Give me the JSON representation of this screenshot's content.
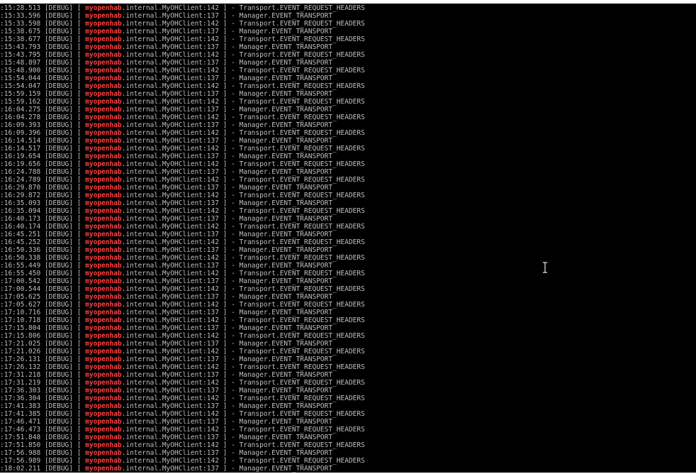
{
  "terminal": {
    "log_lines": [
      {
        "t": ":15:28.513",
        "level": "[DEBUG]",
        "pkg": "myopenhab",
        "cls": ".internal.MyOHClient:142",
        "msg": " ] - Transport.EVENT_REQUEST_HEADERS"
      },
      {
        "t": ":15:33.596",
        "level": "[DEBUG]",
        "pkg": "myopenhab",
        "cls": ".internal.MyOHClient:137",
        "msg": " ] - Manager.EVENT_TRANSPORT"
      },
      {
        "t": ":15:33.598",
        "level": "[DEBUG]",
        "pkg": "myopenhab",
        "cls": ".internal.MyOHClient:142",
        "msg": " ] - Transport.EVENT_REQUEST_HEADERS"
      },
      {
        "t": ":15:38.675",
        "level": "[DEBUG]",
        "pkg": "myopenhab",
        "cls": ".internal.MyOHClient:137",
        "msg": " ] - Manager.EVENT_TRANSPORT"
      },
      {
        "t": ":15:38.677",
        "level": "[DEBUG]",
        "pkg": "myopenhab",
        "cls": ".internal.MyOHClient:142",
        "msg": " ] - Transport.EVENT_REQUEST_HEADERS"
      },
      {
        "t": ":15:43.793",
        "level": "[DEBUG]",
        "pkg": "myopenhab",
        "cls": ".internal.MyOHClient:137",
        "msg": " ] - Manager.EVENT_TRANSPORT"
      },
      {
        "t": ":15:43.795",
        "level": "[DEBUG]",
        "pkg": "myopenhab",
        "cls": ".internal.MyOHClient:142",
        "msg": " ] - Transport.EVENT_REQUEST_HEADERS"
      },
      {
        "t": ":15:48.897",
        "level": "[DEBUG]",
        "pkg": "myopenhab",
        "cls": ".internal.MyOHClient:137",
        "msg": " ] - Manager.EVENT_TRANSPORT"
      },
      {
        "t": ":15:48.900",
        "level": "[DEBUG]",
        "pkg": "myopenhab",
        "cls": ".internal.MyOHClient:142",
        "msg": " ] - Transport.EVENT_REQUEST_HEADERS"
      },
      {
        "t": ":15:54.044",
        "level": "[DEBUG]",
        "pkg": "myopenhab",
        "cls": ".internal.MyOHClient:137",
        "msg": " ] - Manager.EVENT_TRANSPORT"
      },
      {
        "t": ":15:54.047",
        "level": "[DEBUG]",
        "pkg": "myopenhab",
        "cls": ".internal.MyOHClient:142",
        "msg": " ] - Transport.EVENT_REQUEST_HEADERS"
      },
      {
        "t": ":15:59.159",
        "level": "[DEBUG]",
        "pkg": "myopenhab",
        "cls": ".internal.MyOHClient:137",
        "msg": " ] - Manager.EVENT_TRANSPORT"
      },
      {
        "t": ":15:59.162",
        "level": "[DEBUG]",
        "pkg": "myopenhab",
        "cls": ".internal.MyOHClient:142",
        "msg": " ] - Transport.EVENT_REQUEST_HEADERS"
      },
      {
        "t": ":16:04.275",
        "level": "[DEBUG]",
        "pkg": "myopenhab",
        "cls": ".internal.MyOHClient:137",
        "msg": " ] - Manager.EVENT_TRANSPORT"
      },
      {
        "t": ":16:04.278",
        "level": "[DEBUG]",
        "pkg": "myopenhab",
        "cls": ".internal.MyOHClient:142",
        "msg": " ] - Transport.EVENT_REQUEST_HEADERS"
      },
      {
        "t": ":16:09.393",
        "level": "[DEBUG]",
        "pkg": "myopenhab",
        "cls": ".internal.MyOHClient:137",
        "msg": " ] - Manager.EVENT_TRANSPORT"
      },
      {
        "t": ":16:09.396",
        "level": "[DEBUG]",
        "pkg": "myopenhab",
        "cls": ".internal.MyOHClient:142",
        "msg": " ] - Transport.EVENT_REQUEST_HEADERS"
      },
      {
        "t": ":16:14.514",
        "level": "[DEBUG]",
        "pkg": "myopenhab",
        "cls": ".internal.MyOHClient:137",
        "msg": " ] - Manager.EVENT_TRANSPORT"
      },
      {
        "t": ":16:14.517",
        "level": "[DEBUG]",
        "pkg": "myopenhab",
        "cls": ".internal.MyOHClient:142",
        "msg": " ] - Transport.EVENT_REQUEST_HEADERS"
      },
      {
        "t": ":16:19.654",
        "level": "[DEBUG]",
        "pkg": "myopenhab",
        "cls": ".internal.MyOHClient:137",
        "msg": " ] - Manager.EVENT_TRANSPORT"
      },
      {
        "t": ":16:19.656",
        "level": "[DEBUG]",
        "pkg": "myopenhab",
        "cls": ".internal.MyOHClient:142",
        "msg": " ] - Transport.EVENT_REQUEST_HEADERS"
      },
      {
        "t": ":16:24.788",
        "level": "[DEBUG]",
        "pkg": "myopenhab",
        "cls": ".internal.MyOHClient:137",
        "msg": " ] - Manager.EVENT_TRANSPORT"
      },
      {
        "t": ":16:24.789",
        "level": "[DEBUG]",
        "pkg": "myopenhab",
        "cls": ".internal.MyOHClient:142",
        "msg": " ] - Transport.EVENT_REQUEST_HEADERS"
      },
      {
        "t": ":16:29.870",
        "level": "[DEBUG]",
        "pkg": "myopenhab",
        "cls": ".internal.MyOHClient:137",
        "msg": " ] - Manager.EVENT_TRANSPORT"
      },
      {
        "t": ":16:29.872",
        "level": "[DEBUG]",
        "pkg": "myopenhab",
        "cls": ".internal.MyOHClient:142",
        "msg": " ] - Transport.EVENT_REQUEST_HEADERS"
      },
      {
        "t": ":16:35.093",
        "level": "[DEBUG]",
        "pkg": "myopenhab",
        "cls": ".internal.MyOHClient:137",
        "msg": " ] - Manager.EVENT_TRANSPORT"
      },
      {
        "t": ":16:35.094",
        "level": "[DEBUG]",
        "pkg": "myopenhab",
        "cls": ".internal.MyOHClient:142",
        "msg": " ] - Transport.EVENT_REQUEST_HEADERS"
      },
      {
        "t": ":16:40.173",
        "level": "[DEBUG]",
        "pkg": "myopenhab",
        "cls": ".internal.MyOHClient:137",
        "msg": " ] - Manager.EVENT_TRANSPORT"
      },
      {
        "t": ":16:40.174",
        "level": "[DEBUG]",
        "pkg": "myopenhab",
        "cls": ".internal.MyOHClient:142",
        "msg": " ] - Transport.EVENT_REQUEST_HEADERS"
      },
      {
        "t": ":16:45.251",
        "level": "[DEBUG]",
        "pkg": "myopenhab",
        "cls": ".internal.MyOHClient:137",
        "msg": " ] - Manager.EVENT_TRANSPORT"
      },
      {
        "t": ":16:45.252",
        "level": "[DEBUG]",
        "pkg": "myopenhab",
        "cls": ".internal.MyOHClient:142",
        "msg": " ] - Transport.EVENT_REQUEST_HEADERS"
      },
      {
        "t": ":16:50.336",
        "level": "[DEBUG]",
        "pkg": "myopenhab",
        "cls": ".internal.MyOHClient:137",
        "msg": " ] - Manager.EVENT_TRANSPORT"
      },
      {
        "t": ":16:50.338",
        "level": "[DEBUG]",
        "pkg": "myopenhab",
        "cls": ".internal.MyOHClient:142",
        "msg": " ] - Transport.EVENT_REQUEST_HEADERS"
      },
      {
        "t": ":16:55.449",
        "level": "[DEBUG]",
        "pkg": "myopenhab",
        "cls": ".internal.MyOHClient:137",
        "msg": " ] - Manager.EVENT_TRANSPORT"
      },
      {
        "t": ":16:55.450",
        "level": "[DEBUG]",
        "pkg": "myopenhab",
        "cls": ".internal.MyOHClient:142",
        "msg": " ] - Transport.EVENT_REQUEST_HEADERS"
      },
      {
        "t": ":17:00.542",
        "level": "[DEBUG]",
        "pkg": "myopenhab",
        "cls": ".internal.MyOHClient:137",
        "msg": " ] - Manager.EVENT_TRANSPORT"
      },
      {
        "t": ":17:00.544",
        "level": "[DEBUG]",
        "pkg": "myopenhab",
        "cls": ".internal.MyOHClient:142",
        "msg": " ] - Transport.EVENT_REQUEST_HEADERS"
      },
      {
        "t": ":17:05.625",
        "level": "[DEBUG]",
        "pkg": "myopenhab",
        "cls": ".internal.MyOHClient:137",
        "msg": " ] - Manager.EVENT_TRANSPORT"
      },
      {
        "t": ":17:05.627",
        "level": "[DEBUG]",
        "pkg": "myopenhab",
        "cls": ".internal.MyOHClient:142",
        "msg": " ] - Transport.EVENT_REQUEST_HEADERS"
      },
      {
        "t": ":17:10.716",
        "level": "[DEBUG]",
        "pkg": "myopenhab",
        "cls": ".internal.MyOHClient:137",
        "msg": " ] - Manager.EVENT_TRANSPORT"
      },
      {
        "t": ":17:10.718",
        "level": "[DEBUG]",
        "pkg": "myopenhab",
        "cls": ".internal.MyOHClient:142",
        "msg": " ] - Transport.EVENT_REQUEST_HEADERS"
      },
      {
        "t": ":17:15.804",
        "level": "[DEBUG]",
        "pkg": "myopenhab",
        "cls": ".internal.MyOHClient:137",
        "msg": " ] - Manager.EVENT_TRANSPORT"
      },
      {
        "t": ":17:15.806",
        "level": "[DEBUG]",
        "pkg": "myopenhab",
        "cls": ".internal.MyOHClient:142",
        "msg": " ] - Transport.EVENT_REQUEST_HEADERS"
      },
      {
        "t": ":17:21.025",
        "level": "[DEBUG]",
        "pkg": "myopenhab",
        "cls": ".internal.MyOHClient:137",
        "msg": " ] - Manager.EVENT_TRANSPORT"
      },
      {
        "t": ":17:21.026",
        "level": "[DEBUG]",
        "pkg": "myopenhab",
        "cls": ".internal.MyOHClient:142",
        "msg": " ] - Transport.EVENT_REQUEST_HEADERS"
      },
      {
        "t": ":17:26.131",
        "level": "[DEBUG]",
        "pkg": "myopenhab",
        "cls": ".internal.MyOHClient:137",
        "msg": " ] - Manager.EVENT_TRANSPORT"
      },
      {
        "t": ":17:26.132",
        "level": "[DEBUG]",
        "pkg": "myopenhab",
        "cls": ".internal.MyOHClient:142",
        "msg": " ] - Transport.EVENT_REQUEST_HEADERS"
      },
      {
        "t": ":17:31.218",
        "level": "[DEBUG]",
        "pkg": "myopenhab",
        "cls": ".internal.MyOHClient:137",
        "msg": " ] - Manager.EVENT_TRANSPORT"
      },
      {
        "t": ":17:31.219",
        "level": "[DEBUG]",
        "pkg": "myopenhab",
        "cls": ".internal.MyOHClient:142",
        "msg": " ] - Transport.EVENT_REQUEST_HEADERS"
      },
      {
        "t": ":17:36.303",
        "level": "[DEBUG]",
        "pkg": "myopenhab",
        "cls": ".internal.MyOHClient:137",
        "msg": " ] - Manager.EVENT_TRANSPORT"
      },
      {
        "t": ":17:36.304",
        "level": "[DEBUG]",
        "pkg": "myopenhab",
        "cls": ".internal.MyOHClient:142",
        "msg": " ] - Transport.EVENT_REQUEST_HEADERS"
      },
      {
        "t": ":17:41.383",
        "level": "[DEBUG]",
        "pkg": "myopenhab",
        "cls": ".internal.MyOHClient:137",
        "msg": " ] - Manager.EVENT_TRANSPORT"
      },
      {
        "t": ":17:41.385",
        "level": "[DEBUG]",
        "pkg": "myopenhab",
        "cls": ".internal.MyOHClient:142",
        "msg": " ] - Transport.EVENT_REQUEST_HEADERS"
      },
      {
        "t": ":17:46.471",
        "level": "[DEBUG]",
        "pkg": "myopenhab",
        "cls": ".internal.MyOHClient:137",
        "msg": " ] - Manager.EVENT_TRANSPORT"
      },
      {
        "t": ":17:46.473",
        "level": "[DEBUG]",
        "pkg": "myopenhab",
        "cls": ".internal.MyOHClient:142",
        "msg": " ] - Transport.EVENT_REQUEST_HEADERS"
      },
      {
        "t": ":17:51.848",
        "level": "[DEBUG]",
        "pkg": "myopenhab",
        "cls": ".internal.MyOHClient:137",
        "msg": " ] - Manager.EVENT_TRANSPORT"
      },
      {
        "t": ":17:51.850",
        "level": "[DEBUG]",
        "pkg": "myopenhab",
        "cls": ".internal.MyOHClient:142",
        "msg": " ] - Transport.EVENT_REQUEST_HEADERS"
      },
      {
        "t": ":17:56.988",
        "level": "[DEBUG]",
        "pkg": "myopenhab",
        "cls": ".internal.MyOHClient:137",
        "msg": " ] - Manager.EVENT_TRANSPORT"
      },
      {
        "t": ":17:56.989",
        "level": "[DEBUG]",
        "pkg": "myopenhab",
        "cls": ".internal.MyOHClient:142",
        "msg": " ] - Transport.EVENT_REQUEST_HEADERS"
      },
      {
        "t": ":18:02.211",
        "level": "[DEBUG]",
        "pkg": "myopenhab",
        "cls": ".internal.MyOHClient:137",
        "msg": " ] - Manager.EVENT_TRANSPORT"
      }
    ]
  },
  "colors": {
    "background": "#000000",
    "text": "#bfbfbf",
    "package": "#ff4040"
  },
  "cursor": {
    "icon": "text-cursor-icon"
  }
}
